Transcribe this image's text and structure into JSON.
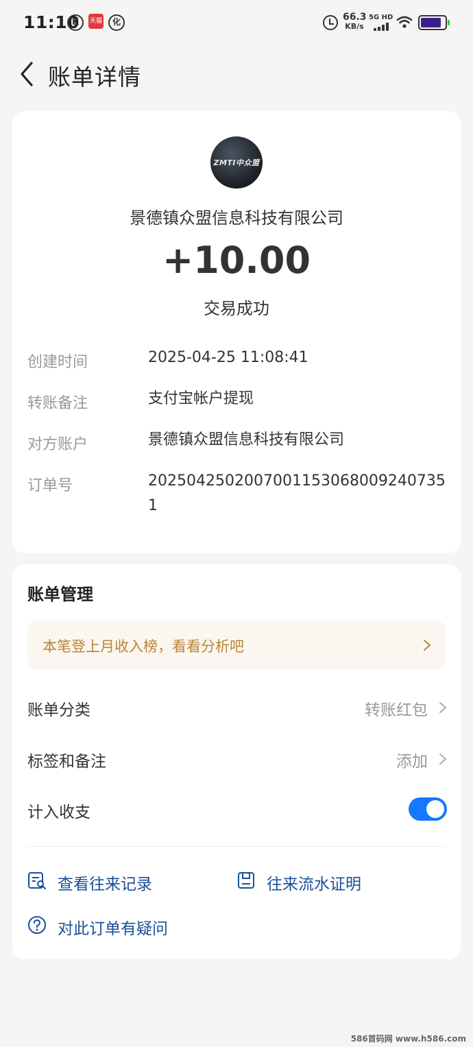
{
  "status_bar": {
    "time": "11:10",
    "k_icon": "K",
    "tmall_icon": "天猫",
    "pay_icon": "化",
    "speed_value": "66.3",
    "speed_unit": "KB/s",
    "network": "5G HD"
  },
  "header": {
    "title": "账单详情"
  },
  "transaction": {
    "avatar_logo_text": "ZMTI中众盟",
    "merchant": "景德镇众盟信息科技有限公司",
    "amount": "+10.00",
    "status": "交易成功"
  },
  "details": [
    {
      "label": "创建时间",
      "value": "2025-04-25 11:08:41"
    },
    {
      "label": "转账备注",
      "value": "支付宝帐户提现"
    },
    {
      "label": "对方账户",
      "value": "景德镇众盟信息科技有限公司"
    },
    {
      "label": "订单号",
      "value": "2025042502007001153068009240735 1"
    }
  ],
  "management": {
    "title": "账单管理",
    "banner": "本笔登上月收入榜，看看分析吧",
    "category_label": "账单分类",
    "category_value": "转账红包",
    "tags_label": "标签和备注",
    "tags_value": "添加",
    "count_label": "计入收支",
    "count_enabled": true
  },
  "links": {
    "history": "查看往来记录",
    "proof": "往来流水证明",
    "question": "对此订单有疑问"
  },
  "watermark": "586首码网 www.h586.com",
  "colors": {
    "accent": "#1677ff",
    "link": "#1a4f98",
    "banner_text": "#b8863a",
    "banner_bg": "#fbf6ef"
  }
}
